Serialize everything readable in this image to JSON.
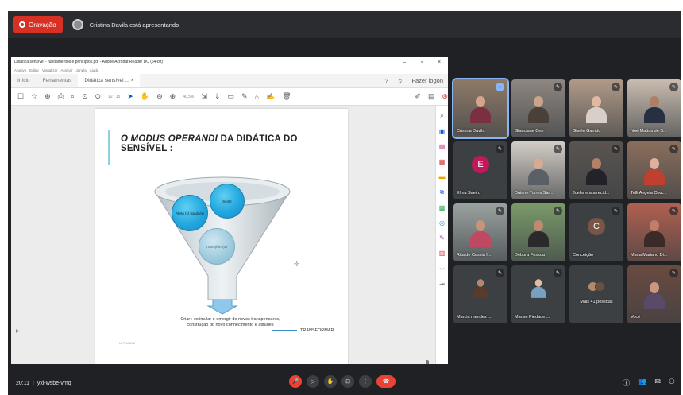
{
  "colors": {
    "recording": "#d93025",
    "accent_blue": "#8ab4f8",
    "end_call": "#ea4335",
    "background": "#202124"
  },
  "topbar": {
    "recording_label": "Gravação",
    "presenting_text": "Cristina Davila está apresentando"
  },
  "shared_window": {
    "title": "Didática sensível - fundamentos e princípios.pdf - Adobe Acrobat Reader DC (64-bit)",
    "menu": [
      "Arquivo",
      "Editar",
      "Visualizar",
      "Assinar",
      "Janela",
      "Ajuda"
    ],
    "tabs": [
      "Início",
      "Ferramentas",
      "Didática sensível ... ×"
    ],
    "login_label": "Fazer logon",
    "page_indicator": "12 / 15",
    "zoom": "40,5%",
    "slide": {
      "title_italic": "O MODUS OPERANDI",
      "title_rest": "DA DIDÁTICA DO SENSÍVEL :",
      "bubble_left": "Afeto (s) ligado(s)",
      "bubble_right": "Sentir",
      "bubble_bottom": "Trans(form)ar",
      "caption": "Criar : estimular o emergir de novos transpensares, construção do novo conhecimento e atitudes",
      "transform_label": "TRANSFORMAR",
      "footer": "UFRJ/BCM"
    }
  },
  "participants": [
    {
      "name": "Cristina Davila",
      "type": "video",
      "active": true,
      "skin": "#d7a48a",
      "shirt": "#7a3040",
      "bg": "#8d7a68"
    },
    {
      "name": "Glauciane Cen",
      "type": "video",
      "skin": "#caa58c",
      "shirt": "#4a4038",
      "bg": "#8e8680"
    },
    {
      "name": "Gisele Garrido",
      "type": "video",
      "skin": "#e4b8a0",
      "shirt": "#d8d0c8",
      "bg": "#b09a88"
    },
    {
      "name": "Noé Mattos de S...",
      "type": "video",
      "skin": "#b07e62",
      "shirt": "#263040",
      "bg": "#c9bcb0"
    },
    {
      "name": "Elma Saeiro",
      "type": "avatar",
      "letter": "E",
      "avatar_color": "#c2185b"
    },
    {
      "name": "Daiane Torres Sar...",
      "type": "video",
      "skin": "#d6ab90",
      "shirt": "#5a5f68",
      "bg": "#d3cdc6"
    },
    {
      "name": "Joelene aparecid...",
      "type": "video",
      "skin": "#b58068",
      "shirt": "#222228",
      "bg": "#5a5450"
    },
    {
      "name": "Telli Angela Cou...",
      "type": "video",
      "skin": "#e0b09a",
      "shirt": "#c04030",
      "bg": "#8a6e5c"
    },
    {
      "name": "Rita de Cassia I...",
      "type": "video",
      "skin": "#c89478",
      "shirt": "#c04860",
      "bg": "#9aa2a0"
    },
    {
      "name": "Débora Pessoa",
      "type": "video",
      "skin": "#c08a70",
      "shirt": "#2a2a2a",
      "bg": "#7a9a6a"
    },
    {
      "name": "Conceição",
      "type": "avatar",
      "letter": "C",
      "avatar_color": "#795548"
    },
    {
      "name": "Maria Mariano Di...",
      "type": "video",
      "skin": "#c08068",
      "shirt": "#3a2a28",
      "bg": "#b06050"
    },
    {
      "name": "Marcia mendes ...",
      "type": "photo",
      "skin": "#b8866a",
      "shirt": "#5a3a2a",
      "bg": "#3c4043"
    },
    {
      "name": "Marise Piedade ...",
      "type": "photo",
      "skin": "#e2bba4",
      "shirt": "#7aa0c0",
      "bg": "#3c4043"
    },
    {
      "name": "Mais 41 pessoas",
      "type": "more"
    },
    {
      "name": "Você",
      "type": "video",
      "skin": "#c89880",
      "shirt": "#5a4a6a",
      "bg": "#6a4a40"
    }
  ],
  "bottombar": {
    "time": "20:11",
    "separator": "|",
    "meeting_code": "yxi-wsbe-vmq"
  }
}
